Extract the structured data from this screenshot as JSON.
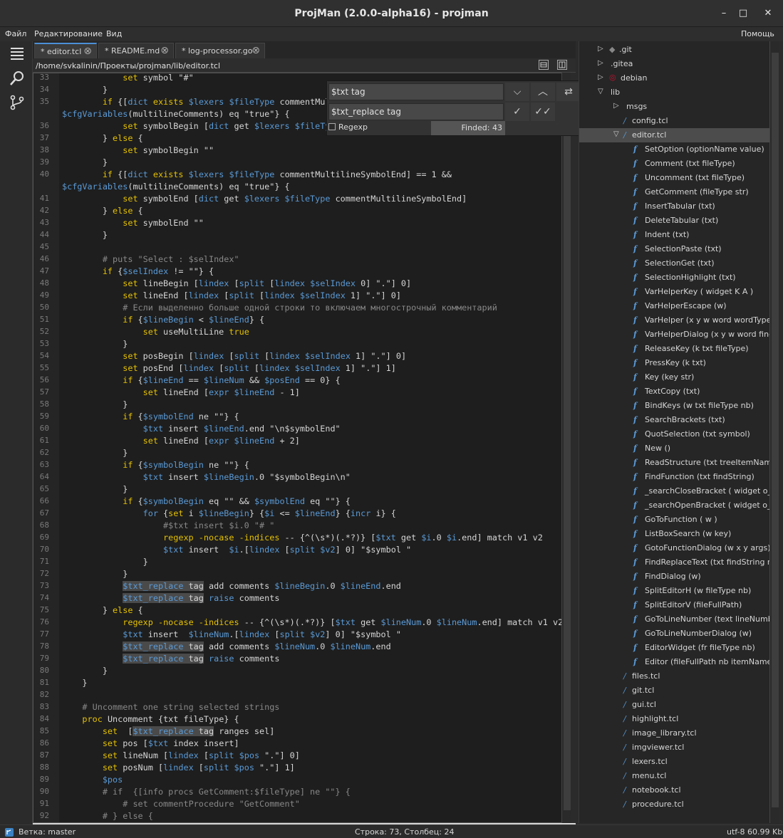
{
  "window": {
    "title": "ProjMan (2.0.0-alpha16) - projman",
    "minimize": "–",
    "maximize": "□",
    "close": "✕"
  },
  "menu": {
    "file": "Файл",
    "edit": "Редактирование",
    "view": "Вид",
    "help": "Помощь"
  },
  "tabs": [
    {
      "label": "* editor.tcl"
    },
    {
      "label": "* README.md"
    },
    {
      "label": "* log-processor.go"
    }
  ],
  "path": "/home/svkalinin/Проекты/projman/lib/editor.tcl",
  "find": {
    "search_value": "$txt tag",
    "replace_value": "$txt_replace tag",
    "regexp_label": "Regexp",
    "found_text": "Finded: 43"
  },
  "code_lines": [
    {
      "n": "33",
      "html": "            <span class=\"kw\">set</span> symbol \"#\""
    },
    {
      "n": "34",
      "html": "        }"
    },
    {
      "n": "35",
      "html": "        <span class=\"kw\">if</span> {[<span class=\"cmd\">dict</span> <span class=\"kw\">exists</span> <span class=\"vr\">$lexers</span> <span class=\"vr\">$fileType</span> commentMultilineComments] == 1 &&"
    },
    {
      "n": "",
      "html": "<span class=\"vr\">$cfgVariables</span>(multilineComments) eq <span class=\"st\">\"true\"</span>} {"
    },
    {
      "n": "36",
      "html": "            <span class=\"kw\">set</span> symbolBegin [<span class=\"cmd\">dict</span> get <span class=\"vr\">$lexers</span> <span class=\"vr\">$fileType</span> commentMultilineSymbolBegin]"
    },
    {
      "n": "37",
      "html": "        } <span class=\"kw\">else</span> {"
    },
    {
      "n": "38",
      "html": "            <span class=\"kw\">set</span> symbolBegin \"\""
    },
    {
      "n": "39",
      "html": "        }"
    },
    {
      "n": "40",
      "html": "        <span class=\"kw\">if</span> {[<span class=\"cmd\">dict</span> <span class=\"kw\">exists</span> <span class=\"vr\">$lexers</span> <span class=\"vr\">$fileType</span> commentMultilineSymbolEnd] == 1 &&"
    },
    {
      "n": "",
      "html": "<span class=\"vr\">$cfgVariables</span>(multilineComments) eq <span class=\"st\">\"true\"</span>} {"
    },
    {
      "n": "41",
      "html": "            <span class=\"kw\">set</span> symbolEnd [<span class=\"cmd\">dict</span> get <span class=\"vr\">$lexers</span> <span class=\"vr\">$fileType</span> commentMultilineSymbolEnd]"
    },
    {
      "n": "42",
      "html": "        } <span class=\"kw\">else</span> {"
    },
    {
      "n": "43",
      "html": "            <span class=\"kw\">set</span> symbolEnd \"\""
    },
    {
      "n": "44",
      "html": "        }"
    },
    {
      "n": "45",
      "html": ""
    },
    {
      "n": "46",
      "html": "        <span class=\"cm\"># puts \"Select : $selIndex\"</span>"
    },
    {
      "n": "47",
      "html": "        <span class=\"kw\">if</span> {<span class=\"vr\">$selIndex</span> != \"\"} {"
    },
    {
      "n": "48",
      "html": "            <span class=\"kw\">set</span> lineBegin [<span class=\"cmd\">lindex</span> [<span class=\"cmd\">split</span> [<span class=\"cmd\">lindex</span> <span class=\"vr\">$selIndex</span> 0] \".\"] 0]"
    },
    {
      "n": "49",
      "html": "            <span class=\"kw\">set</span> lineEnd [<span class=\"cmd\">lindex</span> [<span class=\"cmd\">split</span> [<span class=\"cmd\">lindex</span> <span class=\"vr\">$selIndex</span> 1] \".\"] 0]"
    },
    {
      "n": "50",
      "html": "            <span class=\"cm\"># Если выделенно больше одной строки то включаем многострочный комментарий</span>"
    },
    {
      "n": "51",
      "html": "            <span class=\"kw\">if</span> {<span class=\"vr\">$lineBegin</span> < <span class=\"vr\">$lineEnd</span>} {"
    },
    {
      "n": "52",
      "html": "                <span class=\"kw\">set</span> useMultiLine <span class=\"kw\">true</span>"
    },
    {
      "n": "53",
      "html": "            }"
    },
    {
      "n": "54",
      "html": "            <span class=\"kw\">set</span> posBegin [<span class=\"cmd\">lindex</span> [<span class=\"cmd\">split</span> [<span class=\"cmd\">lindex</span> <span class=\"vr\">$selIndex</span> 1] \".\"] 0]"
    },
    {
      "n": "55",
      "html": "            <span class=\"kw\">set</span> posEnd [<span class=\"cmd\">lindex</span> [<span class=\"cmd\">split</span> [<span class=\"cmd\">lindex</span> <span class=\"vr\">$selIndex</span> 1] \".\"] 1]"
    },
    {
      "n": "56",
      "html": "            <span class=\"kw\">if</span> {<span class=\"vr\">$lineEnd</span> == <span class=\"vr\">$lineNum</span> && <span class=\"vr\">$posEnd</span> == 0} {"
    },
    {
      "n": "57",
      "html": "                <span class=\"kw\">set</span> lineEnd [<span class=\"cmd\">expr</span> <span class=\"vr\">$lineEnd</span> - 1]"
    },
    {
      "n": "58",
      "html": "            }"
    },
    {
      "n": "59",
      "html": "            <span class=\"kw\">if</span> {<span class=\"vr\">$symbolEnd</span> ne \"\"} {"
    },
    {
      "n": "60",
      "html": "                <span class=\"vr\">$txt</span> insert <span class=\"vr\">$lineEnd</span>.end \"\\n$symbolEnd\""
    },
    {
      "n": "61",
      "html": "                <span class=\"kw\">set</span> lineEnd [<span class=\"cmd\">expr</span> <span class=\"vr\">$lineEnd</span> + 2]"
    },
    {
      "n": "62",
      "html": "            }"
    },
    {
      "n": "63",
      "html": "            <span class=\"kw\">if</span> {<span class=\"vr\">$symbolBegin</span> ne \"\"} {"
    },
    {
      "n": "64",
      "html": "                <span class=\"vr\">$txt</span> insert <span class=\"vr\">$lineBegin</span>.0 \"$symbolBegin\\n\""
    },
    {
      "n": "65",
      "html": "            }"
    },
    {
      "n": "66",
      "html": "            <span class=\"kw\">if</span> {<span class=\"vr\">$symbolBegin</span> eq \"\" && <span class=\"vr\">$symbolEnd</span> eq \"\"} {"
    },
    {
      "n": "67",
      "html": "                <span class=\"vr\">for</span> {<span class=\"kw\">set</span> i <span class=\"vr\">$lineBegin</span>} {<span class=\"vr\">$i</span> <= <span class=\"vr\">$lineEnd</span>} {<span class=\"cmd\">incr</span> i} {"
    },
    {
      "n": "68",
      "html": "                    <span class=\"cm\">#$txt insert $i.0 \"# \"</span>"
    },
    {
      "n": "69",
      "html": "                    <span class=\"kw\">regexp</span> <span class=\"kw\">-nocase -indices</span> -- {^(\\s*)(.*?)} [<span class=\"vr\">$txt</span> get <span class=\"vr\">$i</span>.0 <span class=\"vr\">$i</span>.end] match v1 v2"
    },
    {
      "n": "70",
      "html": "                    <span class=\"vr\">$txt</span> insert  <span class=\"vr\">$i</span>.[<span class=\"cmd\">lindex</span> [<span class=\"cmd\">split</span> <span class=\"vr\">$v2</span>] 0] \"$symbol \""
    },
    {
      "n": "71",
      "html": "                }"
    },
    {
      "n": "72",
      "html": "            }"
    },
    {
      "n": "73",
      "html": "            <span class=\"hl\"><span class=\"vr\">$txt_replace</span> tag</span> add comments <span class=\"vr\">$lineBegin</span>.0 <span class=\"vr\">$lineEnd</span>.end"
    },
    {
      "n": "74",
      "html": "            <span class=\"hl\"><span class=\"vr\">$txt_replace</span> tag</span> <span class=\"cmd\">raise</span> comments"
    },
    {
      "n": "75",
      "html": "        } <span class=\"kw\">else</span> {"
    },
    {
      "n": "76",
      "html": "            <span class=\"kw\">regexp</span> <span class=\"kw\">-nocase -indices</span> -- {^(\\s*)(.*?)} [<span class=\"vr\">$txt</span> get <span class=\"vr\">$lineNum</span>.0 <span class=\"vr\">$lineNum</span>.end] match v1 v2"
    },
    {
      "n": "77",
      "html": "            <span class=\"vr\">$txt</span> insert  <span class=\"vr\">$lineNum</span>.[<span class=\"cmd\">lindex</span> [<span class=\"cmd\">split</span> <span class=\"vr\">$v2</span>] 0] \"$symbol \""
    },
    {
      "n": "78",
      "html": "            <span class=\"hl\"><span class=\"vr\">$txt_replace</span> tag</span> add comments <span class=\"vr\">$lineNum</span>.0 <span class=\"vr\">$lineNum</span>.end"
    },
    {
      "n": "79",
      "html": "            <span class=\"hl\"><span class=\"vr\">$txt_replace</span> tag</span> <span class=\"cmd\">raise</span> comments"
    },
    {
      "n": "80",
      "html": "        }"
    },
    {
      "n": "81",
      "html": "    }"
    },
    {
      "n": "82",
      "html": ""
    },
    {
      "n": "83",
      "html": "    <span class=\"cm\"># Uncomment one string selected strings</span>"
    },
    {
      "n": "84",
      "html": "    <span class=\"kw\">proc</span> Uncomment {txt fileType} {"
    },
    {
      "n": "85",
      "html": "        <span class=\"kw\">set</span>  [<span class=\"hl\"><span class=\"vr\">$txt_replace</span> tag</span> ranges sel]"
    },
    {
      "n": "86",
      "html": "        <span class=\"kw\">set</span> pos [<span class=\"vr\">$txt</span> index insert]"
    },
    {
      "n": "87",
      "html": "        <span class=\"kw\">set</span> lineNum [<span class=\"cmd\">lindex</span> [<span class=\"cmd\">split</span> <span class=\"vr\">$pos</span> \".\"] 0]"
    },
    {
      "n": "88",
      "html": "        <span class=\"kw\">set</span> posNum [<span class=\"cmd\">lindex</span> [<span class=\"cmd\">split</span> <span class=\"vr\">$pos</span> \".\"] 1]"
    },
    {
      "n": "89",
      "html": "        <span class=\"vr\">$pos</span>"
    },
    {
      "n": "90",
      "html": "        <span class=\"cm\"># if  {[info procs GetComment:$fileType] ne \"\"} {</span>"
    },
    {
      "n": "91",
      "html": "            <span class=\"cm\"># set commentProcedure \"GetComment\"</span>"
    },
    {
      "n": "92",
      "html": "        <span class=\"cm\"># } else {</span>"
    }
  ],
  "tree": [
    {
      "label": ".git",
      "indent": 0,
      "arrow": "▷",
      "icon": "git"
    },
    {
      "label": ".gitea",
      "indent": 0,
      "arrow": "▷",
      "icon": ""
    },
    {
      "label": "debian",
      "indent": 0,
      "arrow": "▷",
      "icon": "debian"
    },
    {
      "label": "lib",
      "indent": 0,
      "arrow": "▽",
      "icon": ""
    },
    {
      "label": "msgs",
      "indent": 1,
      "arrow": "▷",
      "icon": ""
    },
    {
      "label": "config.tcl",
      "indent": 1,
      "arrow": "",
      "icon": "file"
    },
    {
      "label": "editor.tcl",
      "indent": 1,
      "arrow": "▽",
      "icon": "file",
      "sel": true
    },
    {
      "label": "SetOption (optionName value)",
      "indent": 2,
      "icon": "fn"
    },
    {
      "label": "Comment (txt fileType)",
      "indent": 2,
      "icon": "fn"
    },
    {
      "label": "Uncomment (txt fileType)",
      "indent": 2,
      "icon": "fn"
    },
    {
      "label": "GetComment (fileType str)",
      "indent": 2,
      "icon": "fn"
    },
    {
      "label": "InsertTabular (txt)",
      "indent": 2,
      "icon": "fn"
    },
    {
      "label": "DeleteTabular (txt)",
      "indent": 2,
      "icon": "fn"
    },
    {
      "label": "Indent (txt)",
      "indent": 2,
      "icon": "fn"
    },
    {
      "label": "SelectionPaste (txt)",
      "indent": 2,
      "icon": "fn"
    },
    {
      "label": "SelectionGet (txt)",
      "indent": 2,
      "icon": "fn"
    },
    {
      "label": "SelectionHighlight (txt)",
      "indent": 2,
      "icon": "fn"
    },
    {
      "label": "VarHelperKey ( widget K A )",
      "indent": 2,
      "icon": "fn"
    },
    {
      "label": "VarHelperEscape (w)",
      "indent": 2,
      "icon": "fn"
    },
    {
      "label": "VarHelper (x y w word wordType)",
      "indent": 2,
      "icon": "fn"
    },
    {
      "label": "VarHelperDialog (x y w word findS",
      "indent": 2,
      "icon": "fn"
    },
    {
      "label": "ReleaseKey (k txt fileType)",
      "indent": 2,
      "icon": "fn"
    },
    {
      "label": "PressKey (k txt)",
      "indent": 2,
      "icon": "fn"
    },
    {
      "label": "Key (key str)",
      "indent": 2,
      "icon": "fn"
    },
    {
      "label": "TextCopy (txt)",
      "indent": 2,
      "icon": "fn"
    },
    {
      "label": "BindKeys (w txt fileType nb)",
      "indent": 2,
      "icon": "fn"
    },
    {
      "label": "SearchBrackets (txt)",
      "indent": 2,
      "icon": "fn"
    },
    {
      "label": "QuotSelection (txt symbol)",
      "indent": 2,
      "icon": "fn"
    },
    {
      "label": "New ()",
      "indent": 2,
      "icon": "fn"
    },
    {
      "label": "ReadStructure (txt treeItemName)",
      "indent": 2,
      "icon": "fn"
    },
    {
      "label": "FindFunction (txt findString)",
      "indent": 2,
      "icon": "fn"
    },
    {
      "label": "_searchCloseBracket ( widget o_bra",
      "indent": 2,
      "icon": "fn"
    },
    {
      "label": "_searchOpenBracket ( widget o_bra",
      "indent": 2,
      "icon": "fn"
    },
    {
      "label": "GoToFunction ( w )",
      "indent": 2,
      "icon": "fn"
    },
    {
      "label": "ListBoxSearch (w key)",
      "indent": 2,
      "icon": "fn"
    },
    {
      "label": "GotoFunctionDialog (w x y args)",
      "indent": 2,
      "icon": "fn"
    },
    {
      "label": "FindReplaceText (txt findString re",
      "indent": 2,
      "icon": "fn"
    },
    {
      "label": "FindDialog (w)",
      "indent": 2,
      "icon": "fn"
    },
    {
      "label": "SplitEditorH (w fileType nb)",
      "indent": 2,
      "icon": "fn"
    },
    {
      "label": "SplitEditorV (fileFullPath)",
      "indent": 2,
      "icon": "fn"
    },
    {
      "label": "GoToLineNumber (text lineNumbe",
      "indent": 2,
      "icon": "fn"
    },
    {
      "label": "GoToLineNumberDialog (w)",
      "indent": 2,
      "icon": "fn"
    },
    {
      "label": "EditorWidget (fr fileType nb)",
      "indent": 2,
      "icon": "fn"
    },
    {
      "label": "Editor (fileFullPath nb itemName)",
      "indent": 2,
      "icon": "fn"
    },
    {
      "label": "files.tcl",
      "indent": 1,
      "icon": "file"
    },
    {
      "label": "git.tcl",
      "indent": 1,
      "icon": "file"
    },
    {
      "label": "gui.tcl",
      "indent": 1,
      "icon": "file"
    },
    {
      "label": "highlight.tcl",
      "indent": 1,
      "icon": "file"
    },
    {
      "label": "image_library.tcl",
      "indent": 1,
      "icon": "file"
    },
    {
      "label": "imgviewer.tcl",
      "indent": 1,
      "icon": "file"
    },
    {
      "label": "lexers.tcl",
      "indent": 1,
      "icon": "file"
    },
    {
      "label": "menu.tcl",
      "indent": 1,
      "icon": "file"
    },
    {
      "label": "notebook.tcl",
      "indent": 1,
      "icon": "file"
    },
    {
      "label": "procedure.tcl",
      "indent": 1,
      "icon": "file"
    }
  ],
  "status": {
    "branch": "Ветка: master",
    "position": "Строка: 73, Столбец: 24",
    "encoding": "utf-8 60.99 Kb"
  },
  "colors": {
    "keyword": "#e5c100",
    "variable": "#5a9ad6",
    "accent": "#4a90d9"
  }
}
